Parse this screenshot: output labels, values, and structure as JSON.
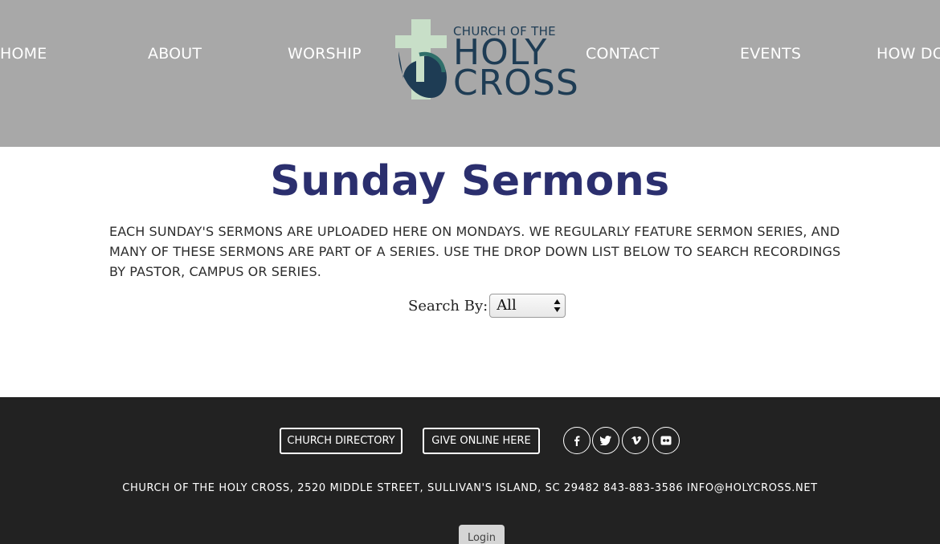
{
  "header": {
    "nav": {
      "home": "HOME",
      "about": "ABOUT",
      "worship": "WORSHIP",
      "contact": "CONTACT",
      "events": "EVENTS",
      "how": "HOW DO"
    },
    "logo": {
      "line1": "CHURCH OF THE",
      "line2": "HOLY",
      "line3": "CROSS"
    }
  },
  "main": {
    "title": "Sunday Sermons",
    "intro": "EACH SUNDAY'S SERMONS ARE UPLOADED HERE ON MONDAYS. WE REGULARLY FEATURE SERMON SERIES, AND MANY OF THESE SERMONS ARE PART OF A SERIES. USE THE DROP DOWN LIST BELOW TO SEARCH RECORDINGS BY PASTOR, CAMPUS OR SERIES.",
    "search": {
      "label": "Search By:",
      "selected": "All"
    }
  },
  "footer": {
    "directory_button": "CHURCH DIRECTORY",
    "give_button": "GIVE ONLINE HERE",
    "social_icons": [
      "facebook-icon",
      "twitter-icon",
      "vimeo-icon",
      "flickr-icon"
    ],
    "address": "CHURCH OF THE HOLY CROSS, 2520 MIDDLE STREET, SULLIVAN'S ISLAND, SC 29482 843-883-3586 INFO@HOLYCROSS.NET",
    "login": "Login"
  },
  "colors": {
    "header_bg": "#a8a8a8",
    "title": "#2b2f6e",
    "footer_bg": "#222222",
    "logo_navy": "#1e3c54",
    "logo_green": "#c8dfc8"
  }
}
